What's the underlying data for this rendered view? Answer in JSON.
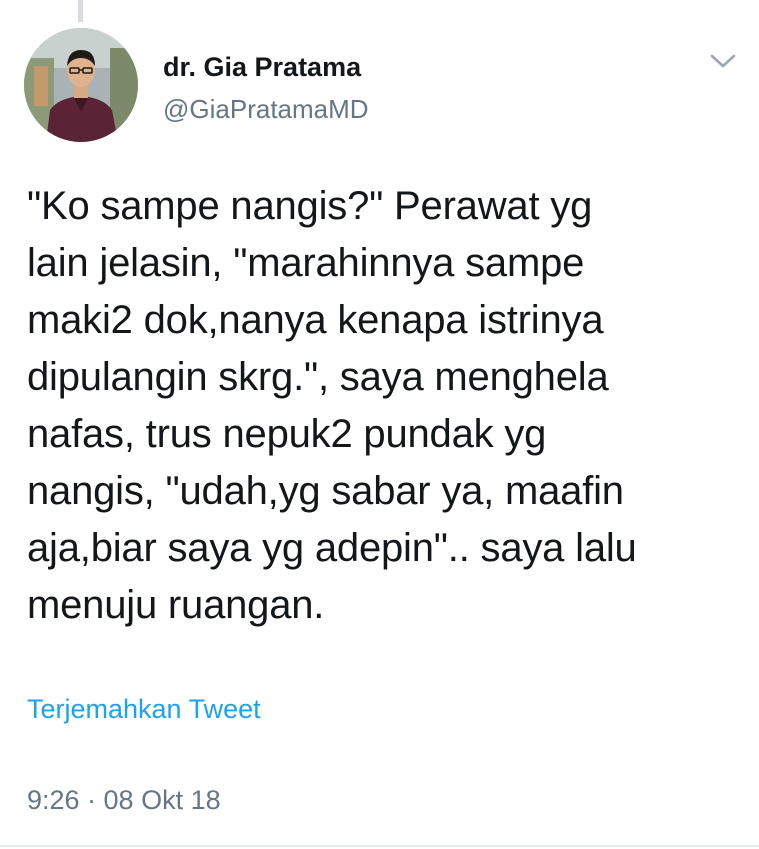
{
  "tweet": {
    "author": {
      "display_name": "dr. Gia Pratama",
      "username": "@GiaPratamaMD",
      "avatar_icon": "profile-photo"
    },
    "text_lines": [
      "\"Ko sampe nangis?\" Perawat yg",
      "lain jelasin, \"marahinnya sampe",
      "maki2 dok,nanya kenapa istrinya",
      "dipulangin skrg.\", saya menghela",
      "nafas, trus nepuk2 pundak yg",
      "nangis, \"udah,yg sabar ya, maafin",
      "aja,biar saya yg adepin\".. saya lalu",
      "menuju ruangan."
    ],
    "translate_label": "Terjemahkan Tweet",
    "timestamp": "9:26 · 08 Okt 18",
    "menu_icon": "chevron-down-icon"
  },
  "colors": {
    "text": "#14171a",
    "secondary": "#657786",
    "link": "#1da1f2"
  }
}
